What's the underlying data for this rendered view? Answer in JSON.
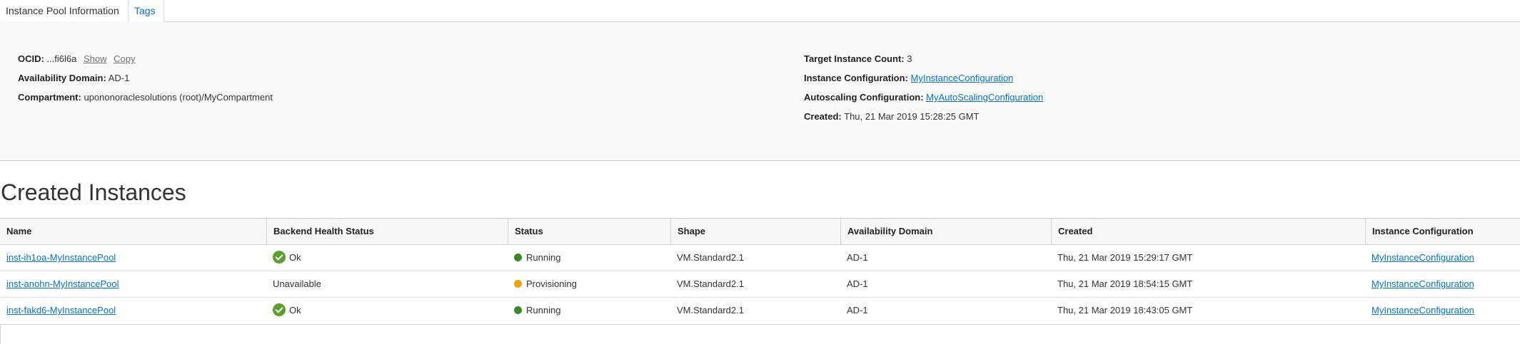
{
  "tabs": {
    "active_label": "Instance Pool Information",
    "tags_label": "Tags"
  },
  "details": {
    "ocid_label": "OCID:",
    "ocid_value": "...fi6l6a",
    "show_label": "Show",
    "copy_label": "Copy",
    "ad_label": "Availability Domain:",
    "ad_value": "AD-1",
    "compartment_label": "Compartment:",
    "compartment_value": "upononoraclesolutions (root)/MyCompartment",
    "target_label": "Target Instance Count:",
    "target_value": "3",
    "instance_config_label": "Instance Configuration:",
    "instance_config_value": "MyInstanceConfiguration",
    "autoscaling_label": "Autoscaling Configuration:",
    "autoscaling_value": "MyAutoScalingConfiguration",
    "created_label": "Created:",
    "created_value": "Thu, 21 Mar 2019 15:28:25 GMT"
  },
  "instances": {
    "title": "Created Instances",
    "columns": [
      "Name",
      "Backend Health Status",
      "Status",
      "Shape",
      "Availability Domain",
      "Created",
      "Instance Configuration"
    ],
    "rows": [
      {
        "name": "inst-ih1oa-MyInstancePool",
        "health": "Ok",
        "health_icon": "check-circle-icon",
        "status": "Running",
        "status_color": "#3a8a2a",
        "shape": "VM.Standard2.1",
        "ad": "AD-1",
        "created": "Thu, 21 Mar 2019 15:29:17 GMT",
        "config": "MyInstanceConfiguration"
      },
      {
        "name": "inst-anohn-MyInstancePool",
        "health": "Unavailable",
        "health_icon": "",
        "status": "Provisioning",
        "status_color": "#f0a30a",
        "shape": "VM.Standard2.1",
        "ad": "AD-1",
        "created": "Thu, 21 Mar 2019 18:54:15 GMT",
        "config": "MyInstanceConfiguration"
      },
      {
        "name": "inst-fakd6-MyInstancePool",
        "health": "Ok",
        "health_icon": "check-circle-icon",
        "status": "Running",
        "status_color": "#3a8a2a",
        "shape": "VM.Standard2.1",
        "ad": "AD-1",
        "created": "Thu, 21 Mar 2019 18:43:05 GMT",
        "config": "MyInstanceConfiguration"
      }
    ]
  }
}
